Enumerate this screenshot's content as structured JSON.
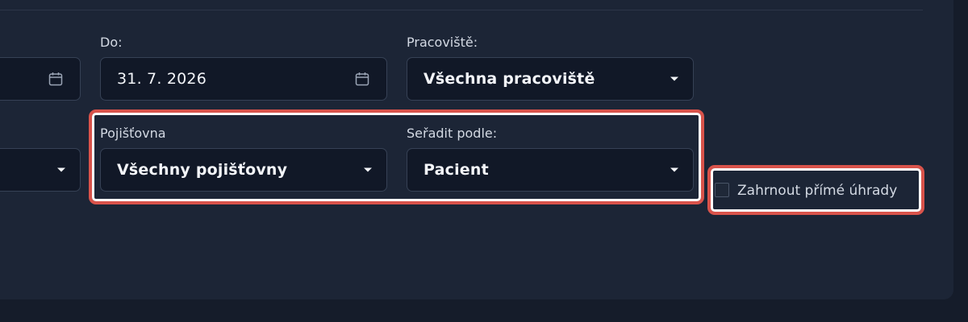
{
  "filters": {
    "from_date": {
      "icon": "calendar-icon"
    },
    "to_date": {
      "label": "Do:",
      "value": "31. 7. 2026",
      "icon": "calendar-icon"
    },
    "workplace": {
      "label": "Pracoviště:",
      "value": "Všechna pracoviště"
    },
    "insurer": {
      "label": "Pojišťovna",
      "value": "Všechny pojišťovny"
    },
    "sort_by": {
      "label": "Seřadit podle:",
      "value": "Pacient"
    },
    "direct_payments": {
      "label": "Zahrnout přímé úhrady",
      "checked": false
    }
  },
  "colors": {
    "highlight": "#d9534b",
    "panel": "#1c2536",
    "field": "#111827"
  }
}
